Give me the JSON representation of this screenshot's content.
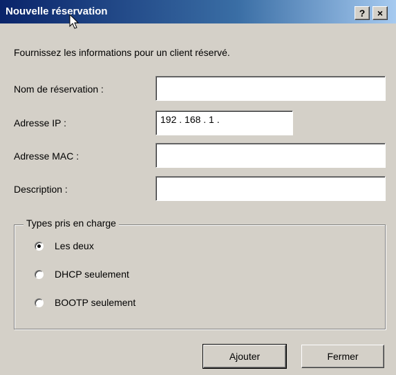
{
  "window": {
    "title": "Nouvelle réservation",
    "help_label": "?",
    "close_label": "×"
  },
  "intro": "Fournissez les informations pour un client réservé.",
  "fields": {
    "name_label": "Nom de réservation :",
    "name_value": "",
    "ip_label": "Adresse IP :",
    "ip_value": "192 . 168 .  1  .",
    "mac_label": "Adresse MAC :",
    "mac_value": "",
    "desc_label": "Description :",
    "desc_value": ""
  },
  "types": {
    "legend": "Types pris en charge",
    "options": [
      {
        "label": "Les deux",
        "checked": true
      },
      {
        "label": "DHCP seulement",
        "checked": false
      },
      {
        "label": "BOOTP seulement",
        "checked": false
      }
    ]
  },
  "buttons": {
    "add": "Ajouter",
    "close": "Fermer"
  },
  "colors": {
    "titlebar_start": "#0a246a",
    "titlebar_end": "#a6caf0",
    "dialog_bg": "#d4d0c8"
  }
}
